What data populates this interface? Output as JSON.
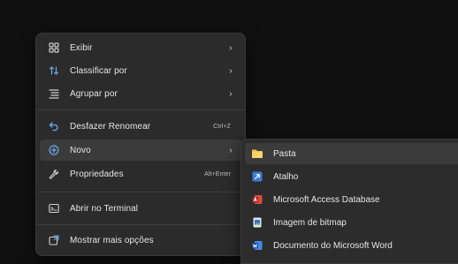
{
  "context_menu": {
    "items": [
      {
        "label": "Exibir",
        "icon": "view-grid-icon"
      },
      {
        "label": "Classificar por",
        "icon": "sort-icon"
      },
      {
        "label": "Agrupar por",
        "icon": "group-icon"
      },
      {
        "label": "Desfazer Renomear",
        "shortcut": "Ctrl+Z",
        "icon": "undo-icon"
      },
      {
        "label": "Novo",
        "icon": "new-plus-icon"
      },
      {
        "label": "Propriedades",
        "shortcut": "Alt+Enter",
        "icon": "properties-wrench-icon"
      },
      {
        "label": "Abrir no Terminal",
        "icon": "terminal-icon"
      },
      {
        "label": "Mostrar mais opções",
        "icon": "more-options-icon"
      }
    ]
  },
  "new_submenu": {
    "items": [
      {
        "label": "Pasta",
        "icon": "folder-icon"
      },
      {
        "label": "Atalho",
        "icon": "shortcut-icon"
      },
      {
        "label": "Microsoft Access Database",
        "icon": "access-database-icon"
      },
      {
        "label": "Imagem de bitmap",
        "icon": "bitmap-image-icon"
      },
      {
        "label": "Documento do Microsoft Word",
        "icon": "word-document-icon"
      }
    ]
  },
  "colors": {
    "menu_bg": "#2b2b2b",
    "highlight": "#3b3b3b",
    "accent_blue": "#6aa8e8",
    "folder_yellow": "#f3c44b",
    "access_red": "#c0392b",
    "word_blue": "#2b63c6"
  }
}
